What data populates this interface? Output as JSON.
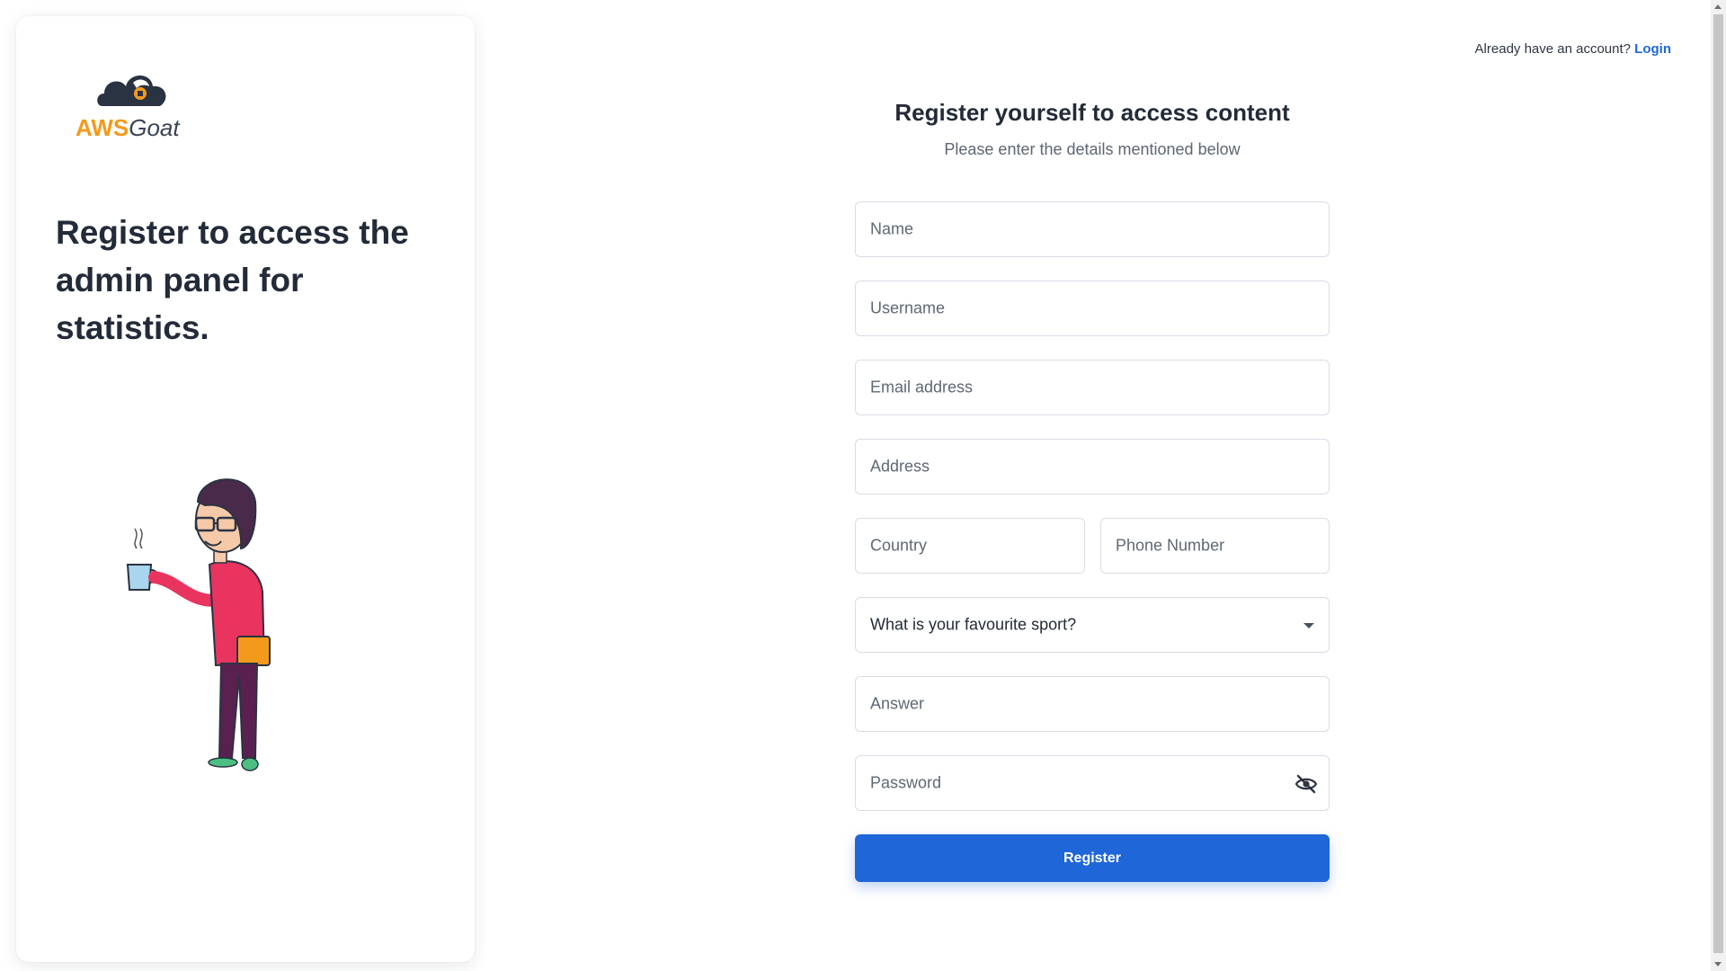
{
  "brand": {
    "aws": "AWS",
    "goat": "Goat"
  },
  "side": {
    "hero_text": "Register to access the admin panel for statistics."
  },
  "header": {
    "prompt": "Already have an account?",
    "login_link": "Login"
  },
  "form": {
    "title": "Register yourself to access content",
    "subtitle": "Please enter the details mentioned below",
    "name_placeholder": "Name",
    "username_placeholder": "Username",
    "email_placeholder": "Email address",
    "address_placeholder": "Address",
    "country_placeholder": "Country",
    "phone_placeholder": "Phone Number",
    "sport_select": "What is your favourite sport?",
    "answer_placeholder": "Answer",
    "password_placeholder": "Password",
    "register_label": "Register"
  },
  "icons": {
    "password_toggle": "eye-slash-icon",
    "select_toggle": "caret-down-icon"
  },
  "colors": {
    "primary": "#1f66d8",
    "brand_orange": "#f39a1c",
    "text_dark": "#232b38"
  }
}
